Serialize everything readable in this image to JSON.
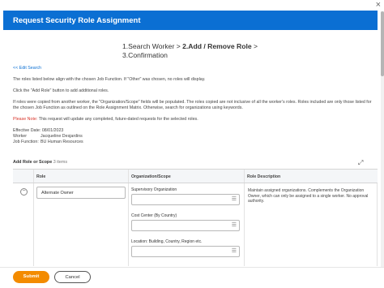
{
  "dialog": {
    "title": "Request Security Role Assignment",
    "close_glyph": "×"
  },
  "steps": {
    "step1": "1.Search Worker >",
    "step2": "2.Add / Remove Role",
    "step2_suffix": " >",
    "step3": "3.Confirmation"
  },
  "body": {
    "edit_search": "<< Edit Search",
    "para1": "The roles listed below align with the chosen Job Function. If \"Other\" was chosen, no roles will display.",
    "para2": "Click the \"Add Role\" button to add additional roles.",
    "para3": "If roles were copied from another worker, the \"Organization/Scope\" fields will be populated. The roles copied are not inclusive of all the worker's roles. Roles included are only those listed for the chosen Job Function as outlined on the Role Assignment Matrix. Otherwise, search for organizations using keywords.",
    "note_label": "Please Note:",
    "note_text": " This request will update any completed, future-dated requests for the selected roles.",
    "effective_date": "Effective Date: 08/01/2023",
    "worker_key": "Worker",
    "worker_value": "Jacqueline Desjardins",
    "job_function_key": "Job Function:",
    "job_function_value": "BU Human Resources"
  },
  "table": {
    "title": "Add Role or Scope",
    "count": "3 items",
    "headers": [
      "Role",
      "Organization/Scope",
      "Role Description"
    ],
    "row": {
      "role_value": "Alternate Owner",
      "org_fields": [
        "Supervisory Organization",
        "Cost Center (By Country)",
        "Location: Building, Country, Region etc."
      ],
      "description": "Maintain assigned organizations. Complements the Organization Owner, which can only be assigned to a single worker. No approval authority."
    }
  },
  "footer": {
    "submit_label": "Submit",
    "cancel_label": "Cancel"
  },
  "icons": {
    "close": "close-icon",
    "expand": "expand-icon",
    "remove_row": "minus-circle-icon",
    "prompt": "list-prompt-icon"
  },
  "colors": {
    "header_bg": "#0b6fd3",
    "submit_bg": "#f38b00",
    "note_red": "#d8342a"
  }
}
